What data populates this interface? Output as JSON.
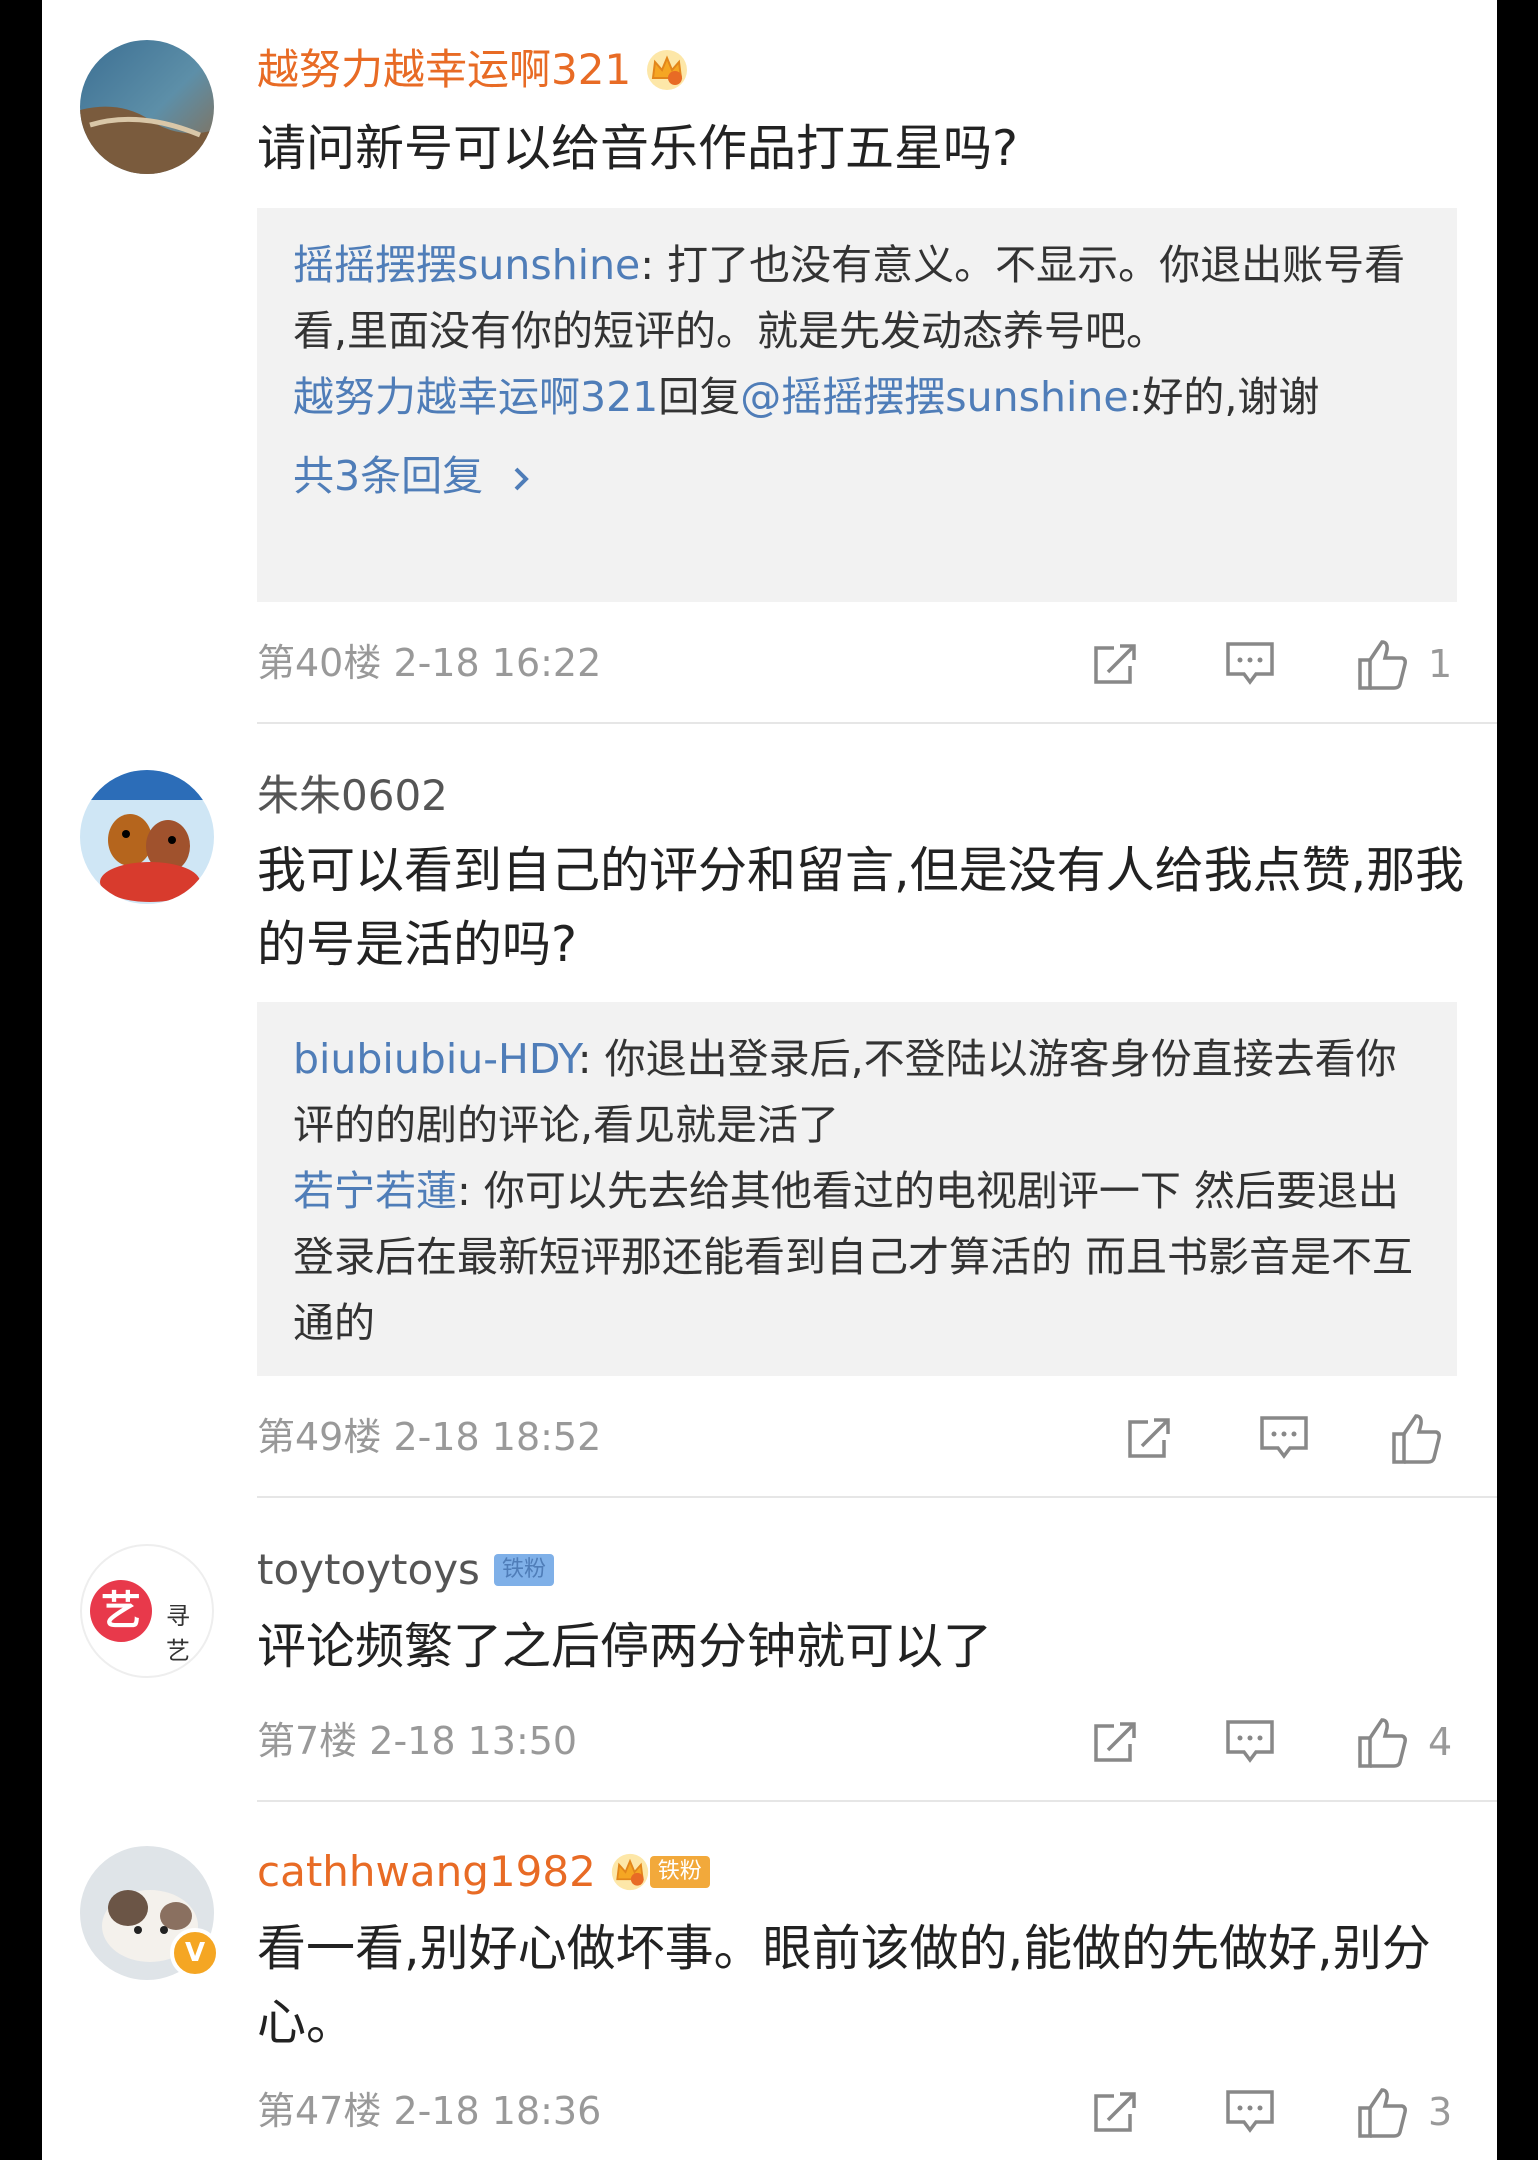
{
  "comments": [
    {
      "username": "越努力越幸运啊321",
      "text": "请问新号可以给音乐作品打五星吗?",
      "replies": [
        {
          "user": "摇摇摆摆sunshine",
          "text": ": 打了也没有意义。不显示。你退出账号看看,里面没有你的短评的。就是先发动态养号吧。"
        },
        {
          "user": "越努力越幸运啊321",
          "mid": "回复",
          "mention": "@摇摇摆摆sunshine",
          "text": ":好的,谢谢"
        }
      ],
      "more_replies": "共3条回复",
      "floor": "第40楼",
      "time": "2-18 16:22",
      "likes": "1"
    },
    {
      "username": "朱朱0602",
      "text": "我可以看到自己的评分和留言,但是没有人给我点赞,那我的号是活的吗?",
      "replies": [
        {
          "user": "biubiubiu-HDY",
          "text": ": 你退出登录后,不登陆以游客身份直接去看你评的的剧的评论,看见就是活了"
        },
        {
          "user": "若宁若蓮",
          "text": ": 你可以先去给其他看过的电视剧评一下 然后要退出登录后在最新短评那还能看到自己才算活的 而且书影音是不互通的"
        }
      ],
      "floor": "第49楼",
      "time": "2-18 18:52",
      "likes": ""
    },
    {
      "username": "toytoytoys",
      "badge": "铁粉",
      "avatar_text": "艺",
      "avatar_sub": "寻艺",
      "text": "评论频繁了之后停两分钟就可以了",
      "floor": "第7楼",
      "time": "2-18 13:50",
      "likes": "4"
    },
    {
      "username": "cathhwang1982",
      "badge": "铁粉",
      "verified_mark": "V",
      "text": "看一看,别好心做坏事。眼前该做的,能做的先做好,别分心。",
      "floor": "第47楼",
      "time": "2-18 18:36",
      "likes": "3"
    }
  ],
  "icons": [
    "share-icon",
    "comment-icon",
    "like-icon",
    "chevron-right-icon",
    "crown-icon"
  ],
  "colors": {
    "orange_name": "#e86b25",
    "link_blue": "#4f7db8",
    "reply_bg": "#f2f2f2",
    "meta_gray": "#999999"
  }
}
